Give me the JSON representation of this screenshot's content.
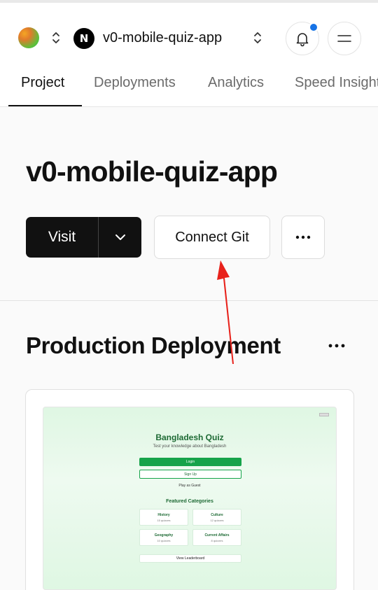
{
  "header": {
    "project_name": "v0-mobile-quiz-app",
    "framework_logo_letter": "N"
  },
  "tabs": [
    {
      "label": "Project",
      "active": true
    },
    {
      "label": "Deployments",
      "active": false
    },
    {
      "label": "Analytics",
      "active": false
    },
    {
      "label": "Speed Insights",
      "active": false
    }
  ],
  "main": {
    "title": "v0-mobile-quiz-app",
    "visit_label": "Visit",
    "connect_git_label": "Connect Git",
    "section_title": "Production Deployment"
  },
  "preview": {
    "title": "Bangladesh Quiz",
    "subtitle": "Test your knowledge about Bangladesh",
    "login_label": "Login",
    "signup_label": "Sign Up",
    "guest_label": "Play as Guest",
    "featured_heading": "Featured Categories",
    "categories": [
      {
        "name": "History",
        "count": "15 quizzes"
      },
      {
        "name": "Culture",
        "count": "12 quizzes"
      },
      {
        "name": "Geography",
        "count": "10 quizzes"
      },
      {
        "name": "Current Affairs",
        "count": "8 quizzes"
      }
    ],
    "leaderboard_label": "View Leaderboard"
  },
  "colors": {
    "notification_dot": "#1673e6",
    "primary_button": "#111111",
    "preview_accent": "#16a34a",
    "annotation_arrow": "#e8221b"
  }
}
